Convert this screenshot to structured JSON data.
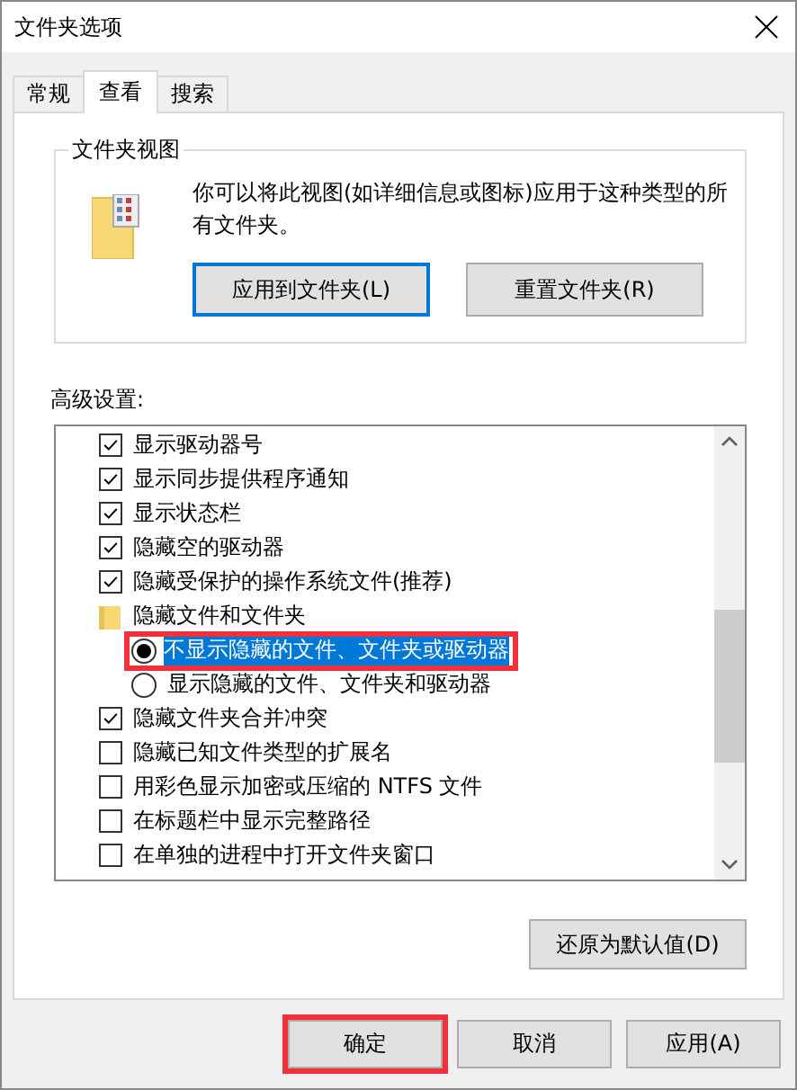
{
  "window": {
    "title": "文件夹选项"
  },
  "tabs": [
    {
      "label": "常规",
      "selected": false
    },
    {
      "label": "查看",
      "selected": true
    },
    {
      "label": "搜索",
      "selected": false
    }
  ],
  "folder_views": {
    "title": "文件夹视图",
    "description": "你可以将此视图(如详细信息或图标)应用于这种类型的所有文件夹。",
    "buttons": [
      {
        "label": "应用到文件夹(L)",
        "focused": true
      },
      {
        "label": "重置文件夹(R)",
        "focused": false
      }
    ]
  },
  "advanced": {
    "label": "高级设置:",
    "items": [
      {
        "kind": "checkbox",
        "label": "显示驱动器号",
        "checked": true
      },
      {
        "kind": "checkbox",
        "label": "显示同步提供程序通知",
        "checked": true
      },
      {
        "kind": "checkbox",
        "label": "显示状态栏",
        "checked": true
      },
      {
        "kind": "checkbox",
        "label": "隐藏空的驱动器",
        "checked": true
      },
      {
        "kind": "checkbox",
        "label": "隐藏受保护的操作系统文件(推荐)",
        "checked": true
      },
      {
        "kind": "folder",
        "label": "隐藏文件和文件夹",
        "children": [
          {
            "kind": "radio",
            "label": "不显示隐藏的文件、文件夹或驱动器",
            "selected": true,
            "highlighted": true
          },
          {
            "kind": "radio",
            "label": "显示隐藏的文件、文件夹和驱动器",
            "selected": false,
            "highlighted": false
          }
        ]
      },
      {
        "kind": "checkbox",
        "label": "隐藏文件夹合并冲突",
        "checked": true
      },
      {
        "kind": "checkbox",
        "label": "隐藏已知文件类型的扩展名",
        "checked": false
      },
      {
        "kind": "checkbox",
        "label": "用彩色显示加密或压缩的 NTFS 文件",
        "checked": false
      },
      {
        "kind": "checkbox",
        "label": "在标题栏中显示完整路径",
        "checked": false
      },
      {
        "kind": "checkbox",
        "label": "在单独的进程中打开文件夹窗口",
        "checked": false
      }
    ],
    "restore_button": "还原为默认值(D)"
  },
  "buttons": [
    {
      "label": "确定",
      "highlighted": true
    },
    {
      "label": "取消",
      "highlighted": false
    },
    {
      "label": "应用(A)",
      "highlighted": false
    }
  ]
}
